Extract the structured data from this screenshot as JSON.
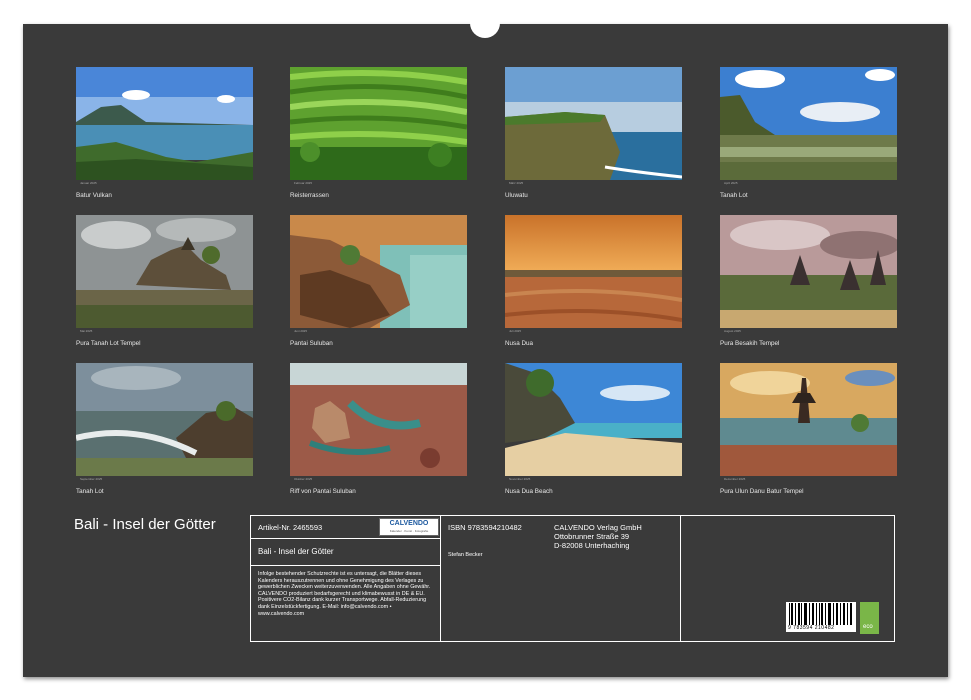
{
  "calendar": {
    "title": "Bali  - Insel der Götter"
  },
  "photos": [
    {
      "caption": "Batur Vulkan",
      "month": "Januar 2025"
    },
    {
      "caption": "Reisterrassen",
      "month": "Februar 2025"
    },
    {
      "caption": "Uluwatu",
      "month": "März 2025"
    },
    {
      "caption": "Tanah Lot",
      "month": "April 2025"
    },
    {
      "caption": "Pura Tanah Lot Tempel",
      "month": "Mai 2025"
    },
    {
      "caption": "Pantai Suluban",
      "month": "Juni 2025"
    },
    {
      "caption": "Nusa Dua",
      "month": "Juli 2025"
    },
    {
      "caption": "Pura Besakih Tempel",
      "month": "August 2025"
    },
    {
      "caption": "Tanah Lot",
      "month": "September 2025"
    },
    {
      "caption": "Riff von Pantai Suluban",
      "month": "Oktober 2025"
    },
    {
      "caption": "Nusa Dua Beach",
      "month": "November 2025"
    },
    {
      "caption": "Pura Ulun Danu Batur Tempel",
      "month": "Dezember 2025"
    }
  ],
  "info": {
    "article": "Artikel-Nr. 2465593",
    "logo_text": "CALVENDO",
    "logo_sub": "Kalender · Kunst · Fotografie",
    "subtitle": "Bali  - Insel der Götter",
    "legal": "Infolge bestehender Schutzrechte ist es untersagt, die Blätter dieses Kalenders herauszutrennen und ohne Genehmigung des Verlages zu gewerblichen Zwecken weiterzuverwenden. Alle Angaben ohne Gewähr. CALVENDO produziert bedarfsgerecht und klimabewusst in DE & EU. Positivere CO2-Bilanz dank kurzer Transportwege. Abfall-Reduzierung dank Einzelstückfertigung. E-Mail: info@calvendo.com • www.calvendo.com",
    "isbn": "ISBN 9783594210482",
    "author": "Stefan Becker",
    "publisher": "CALVENDO Verlag GmbH",
    "street": "Ottobrunner Straße 39",
    "city": "D-82008 Unterhaching",
    "barcode_number": "9 783594 210482",
    "eco_label": "eco"
  }
}
